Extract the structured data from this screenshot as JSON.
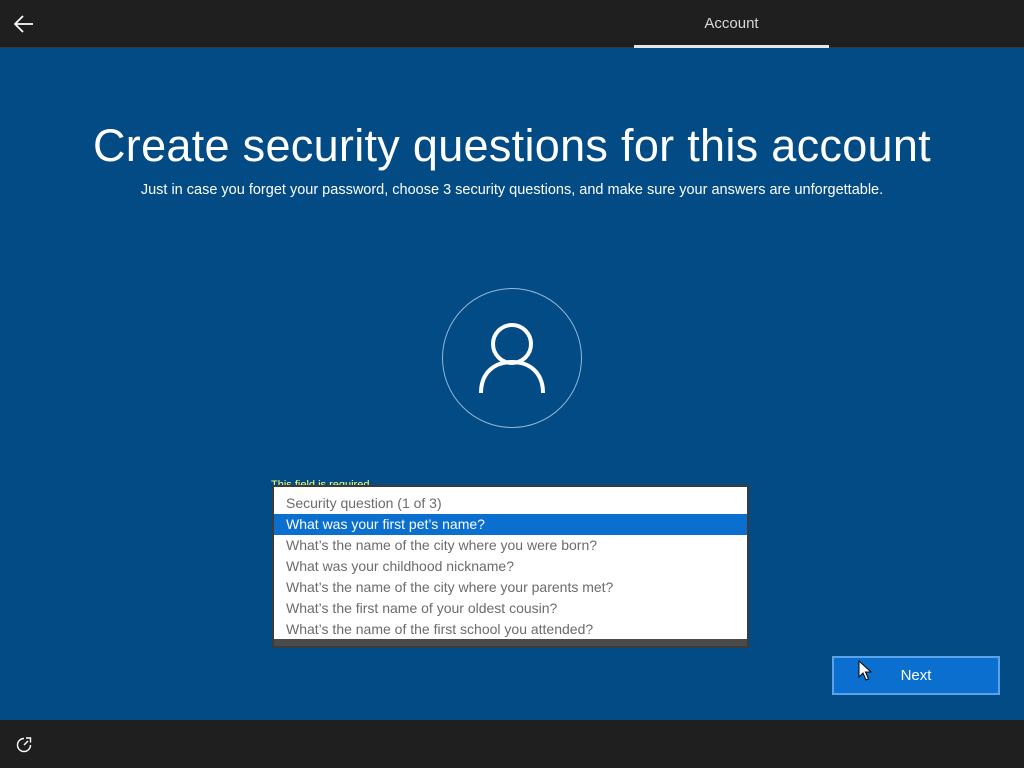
{
  "header": {
    "back_icon": "arrow-left-icon",
    "tab_label": "Account"
  },
  "main": {
    "title": "Create security questions for this account",
    "subtitle": "Just in case you forget your password, choose 3 security questions, and make sure your answers are unforgettable.",
    "avatar_icon": "user-icon",
    "validation_text": "This field is required",
    "dropdown": {
      "options": [
        "Security question (1 of 3)",
        "What was your first pet’s name?",
        "What’s the name of the city where you were born?",
        "What was your childhood nickname?",
        "What’s the name of the city where your parents met?",
        "What’s the first name of your oldest cousin?",
        "What’s the name of the first school you attended?"
      ],
      "highlighted_option": "What was your first pet’s name?"
    },
    "next_label": "Next"
  },
  "footer": {
    "ease_of_access_icon": "ease-of-access-icon"
  },
  "colors": {
    "main_background": "#024b84",
    "bar_background": "#1f1f1f",
    "accent": "#0a6fcf",
    "validation": "#ffff66"
  }
}
